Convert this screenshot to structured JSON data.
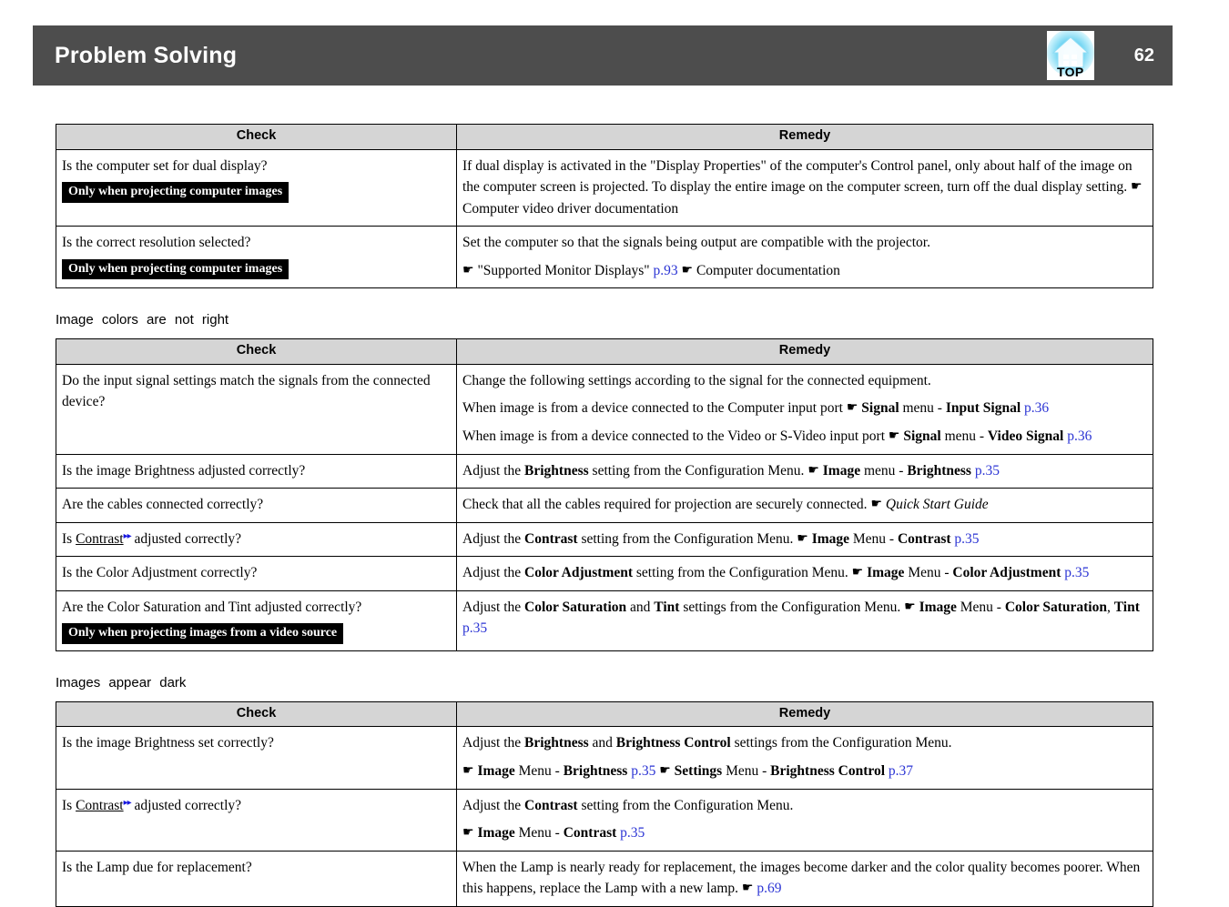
{
  "header": {
    "title": "Problem Solving",
    "page_number": "62",
    "top_icon_label": "TOP",
    "bar_color": "#4d4d4d"
  },
  "colors": {
    "table_header_bg": "#d5d5d5",
    "link": "#2b34d4",
    "glossary_marker": "#1717e0",
    "badge_bg": "#000000"
  },
  "columns": {
    "check": "Check",
    "remedy": "Remedy"
  },
  "sections": [
    {
      "heading": "",
      "rows": [
        {
          "check_text": "Is the computer set for dual display?",
          "check_badge": "Only when projecting computer images",
          "remedy_lines": [
            "If dual display is activated in the \"Display Properties\" of the computer's Control panel, only about half of the image on the computer screen is projected. To display the entire image on the computer screen, turn off the dual display setting. ☛ Computer video driver documentation"
          ]
        },
        {
          "check_text": "Is the correct resolution selected?",
          "check_badge": "Only when projecting computer images",
          "remedy_lines": [
            "Set the computer so that the signals being output are compatible with the projector.",
            "☛ \"Supported Monitor Displays\" p.93 ☛ Computer documentation"
          ]
        }
      ]
    },
    {
      "heading": "Image colors are not right",
      "rows": [
        {
          "check_text": "Do the input signal settings match the signals from the connected device?",
          "check_badge": "",
          "remedy_lines": [
            "Change the following settings according to the signal for the connected equipment.",
            "When image is from a device connected to the Computer input port ☛ Signal menu - Input Signal p.36",
            "When image is from a device connected to the Video or S-Video input port ☛ Signal menu - Video Signal p.36"
          ]
        },
        {
          "check_text": "Is the image Brightness adjusted correctly?",
          "check_badge": "",
          "remedy_lines": [
            "Adjust the Brightness setting from the Configuration Menu. ☛ Image menu - Brightness p.35"
          ]
        },
        {
          "check_text": "Are the cables connected correctly?",
          "check_badge": "",
          "remedy_lines": [
            "Check that all the cables required for projection are securely connected. ☛ Quick Start Guide"
          ]
        },
        {
          "check_text": "Is Contrast adjusted correctly?",
          "check_badge": "",
          "remedy_lines": [
            "Adjust the Contrast setting from the Configuration Menu. ☛ Image Menu - Contrast p.35"
          ]
        },
        {
          "check_text": "Is the Color Adjustment correctly?",
          "check_badge": "",
          "remedy_lines": [
            "Adjust the Color Adjustment setting from the Configuration Menu. ☛ Image Menu - Color Adjustment p.35"
          ]
        },
        {
          "check_text": "Are the Color Saturation and Tint adjusted correctly?",
          "check_badge": "Only when projecting images from a video source",
          "remedy_lines": [
            "Adjust the Color Saturation and Tint settings from the Configuration Menu. ☛ Image Menu - Color Saturation, Tint p.35"
          ]
        }
      ]
    },
    {
      "heading": "Images appear dark",
      "rows": [
        {
          "check_text": "Is the image Brightness set correctly?",
          "check_badge": "",
          "remedy_lines": [
            "Adjust the Brightness and Brightness Control settings from the Configuration Menu.",
            "☛ Image Menu - Brightness p.35 ☛ Settings Menu - Brightness Control p.37"
          ]
        },
        {
          "check_text": "Is Contrast adjusted correctly?",
          "check_badge": "",
          "remedy_lines": [
            "Adjust the Contrast setting from the Configuration Menu.",
            "☛ Image Menu - Contrast p.35"
          ]
        },
        {
          "check_text": "Is the Lamp due for replacement?",
          "check_badge": "",
          "remedy_lines": [
            "When the Lamp is nearly ready for replacement, the images become darker and the color quality becomes poorer. When this happens, replace the Lamp with a new lamp. ☛ p.69"
          ]
        }
      ]
    }
  ],
  "labels": {
    "glossary_marker_glyph": "▸▸",
    "hand_glyph": "☛"
  }
}
